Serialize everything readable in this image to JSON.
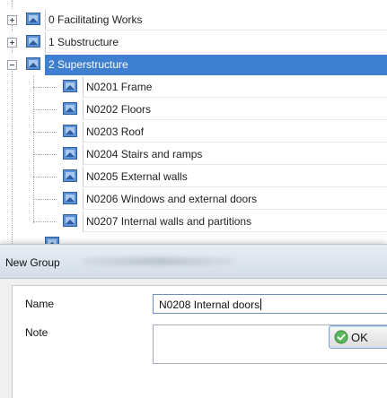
{
  "tree": {
    "items": [
      {
        "label": "0 Facilitating Works",
        "expander": "plus",
        "selected": false,
        "level": 0
      },
      {
        "label": "1 Substructure",
        "expander": "plus",
        "selected": false,
        "level": 0
      },
      {
        "label": "2 Superstructure",
        "expander": "minus",
        "selected": true,
        "level": 0
      },
      {
        "label": "N0201 Frame",
        "level": 1
      },
      {
        "label": "N0202 Floors",
        "level": 1
      },
      {
        "label": "N0203 Roof",
        "level": 1
      },
      {
        "label": "N0204 Stairs and ramps",
        "level": 1
      },
      {
        "label": "N0205 External walls",
        "level": 1
      },
      {
        "label": "N0206 Windows and external doors",
        "level": 1
      },
      {
        "label": "N0207 Internal walls and partitions",
        "level": 1
      }
    ],
    "icon": "group-folder-icon",
    "selection_color": "#3f7fd0"
  },
  "dialog": {
    "title": "New Group",
    "name_label": "Name",
    "name_value": "N0208 Internal doors",
    "note_label": "Note",
    "note_value": "",
    "ok_label": "OK",
    "ok_icon": "check-circle-icon",
    "accent": "#4caf50"
  }
}
